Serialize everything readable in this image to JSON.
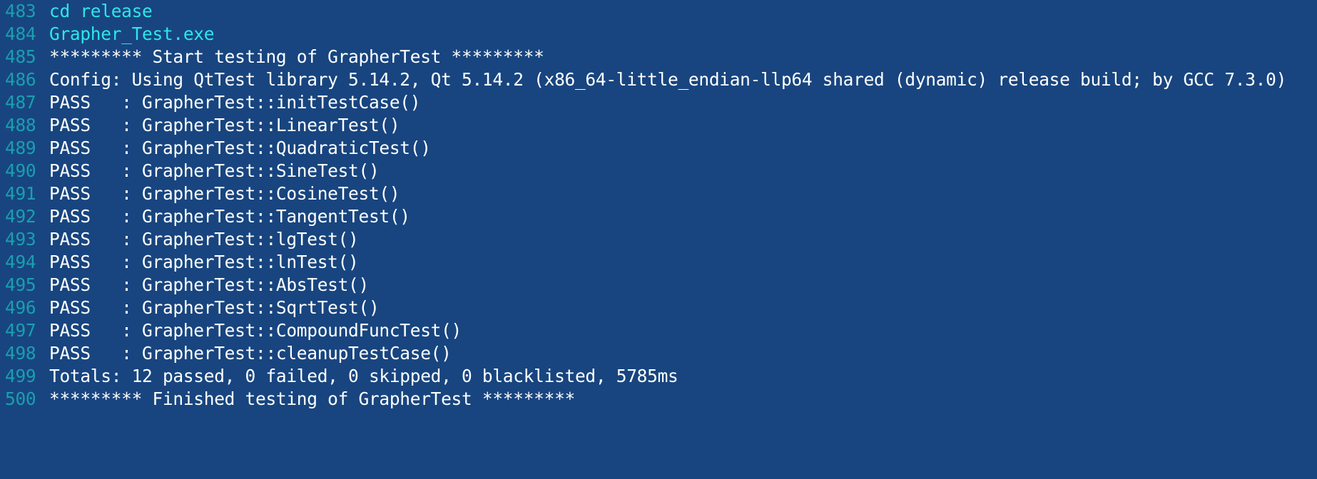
{
  "lines": [
    {
      "n": "483",
      "text": "cd release",
      "kind": "cmd"
    },
    {
      "n": "484",
      "text": "Grapher_Test.exe",
      "kind": "cmd"
    },
    {
      "n": "485",
      "text": "********* Start testing of GrapherTest *********",
      "kind": "out"
    },
    {
      "n": "486",
      "text": "Config: Using QtTest library 5.14.2, Qt 5.14.2 (x86_64-little_endian-llp64 shared (dynamic) release build; by GCC 7.3.0)",
      "kind": "out"
    },
    {
      "n": "487",
      "text": "PASS   : GrapherTest::initTestCase()",
      "kind": "out"
    },
    {
      "n": "488",
      "text": "PASS   : GrapherTest::LinearTest()",
      "kind": "out"
    },
    {
      "n": "489",
      "text": "PASS   : GrapherTest::QuadraticTest()",
      "kind": "out"
    },
    {
      "n": "490",
      "text": "PASS   : GrapherTest::SineTest()",
      "kind": "out"
    },
    {
      "n": "491",
      "text": "PASS   : GrapherTest::CosineTest()",
      "kind": "out"
    },
    {
      "n": "492",
      "text": "PASS   : GrapherTest::TangentTest()",
      "kind": "out"
    },
    {
      "n": "493",
      "text": "PASS   : GrapherTest::lgTest()",
      "kind": "out"
    },
    {
      "n": "494",
      "text": "PASS   : GrapherTest::lnTest()",
      "kind": "out"
    },
    {
      "n": "495",
      "text": "PASS   : GrapherTest::AbsTest()",
      "kind": "out"
    },
    {
      "n": "496",
      "text": "PASS   : GrapherTest::SqrtTest()",
      "kind": "out"
    },
    {
      "n": "497",
      "text": "PASS   : GrapherTest::CompoundFuncTest()",
      "kind": "out"
    },
    {
      "n": "498",
      "text": "PASS   : GrapherTest::cleanupTestCase()",
      "kind": "out"
    },
    {
      "n": "499",
      "text": "Totals: 12 passed, 0 failed, 0 skipped, 0 blacklisted, 5785ms",
      "kind": "out"
    },
    {
      "n": "500",
      "text": "********* Finished testing of GrapherTest *********",
      "kind": "out"
    }
  ],
  "colors": {
    "background": "#18457f",
    "line_number": "#1a9fb0",
    "command": "#2ee6ea",
    "output": "#ffffff"
  }
}
